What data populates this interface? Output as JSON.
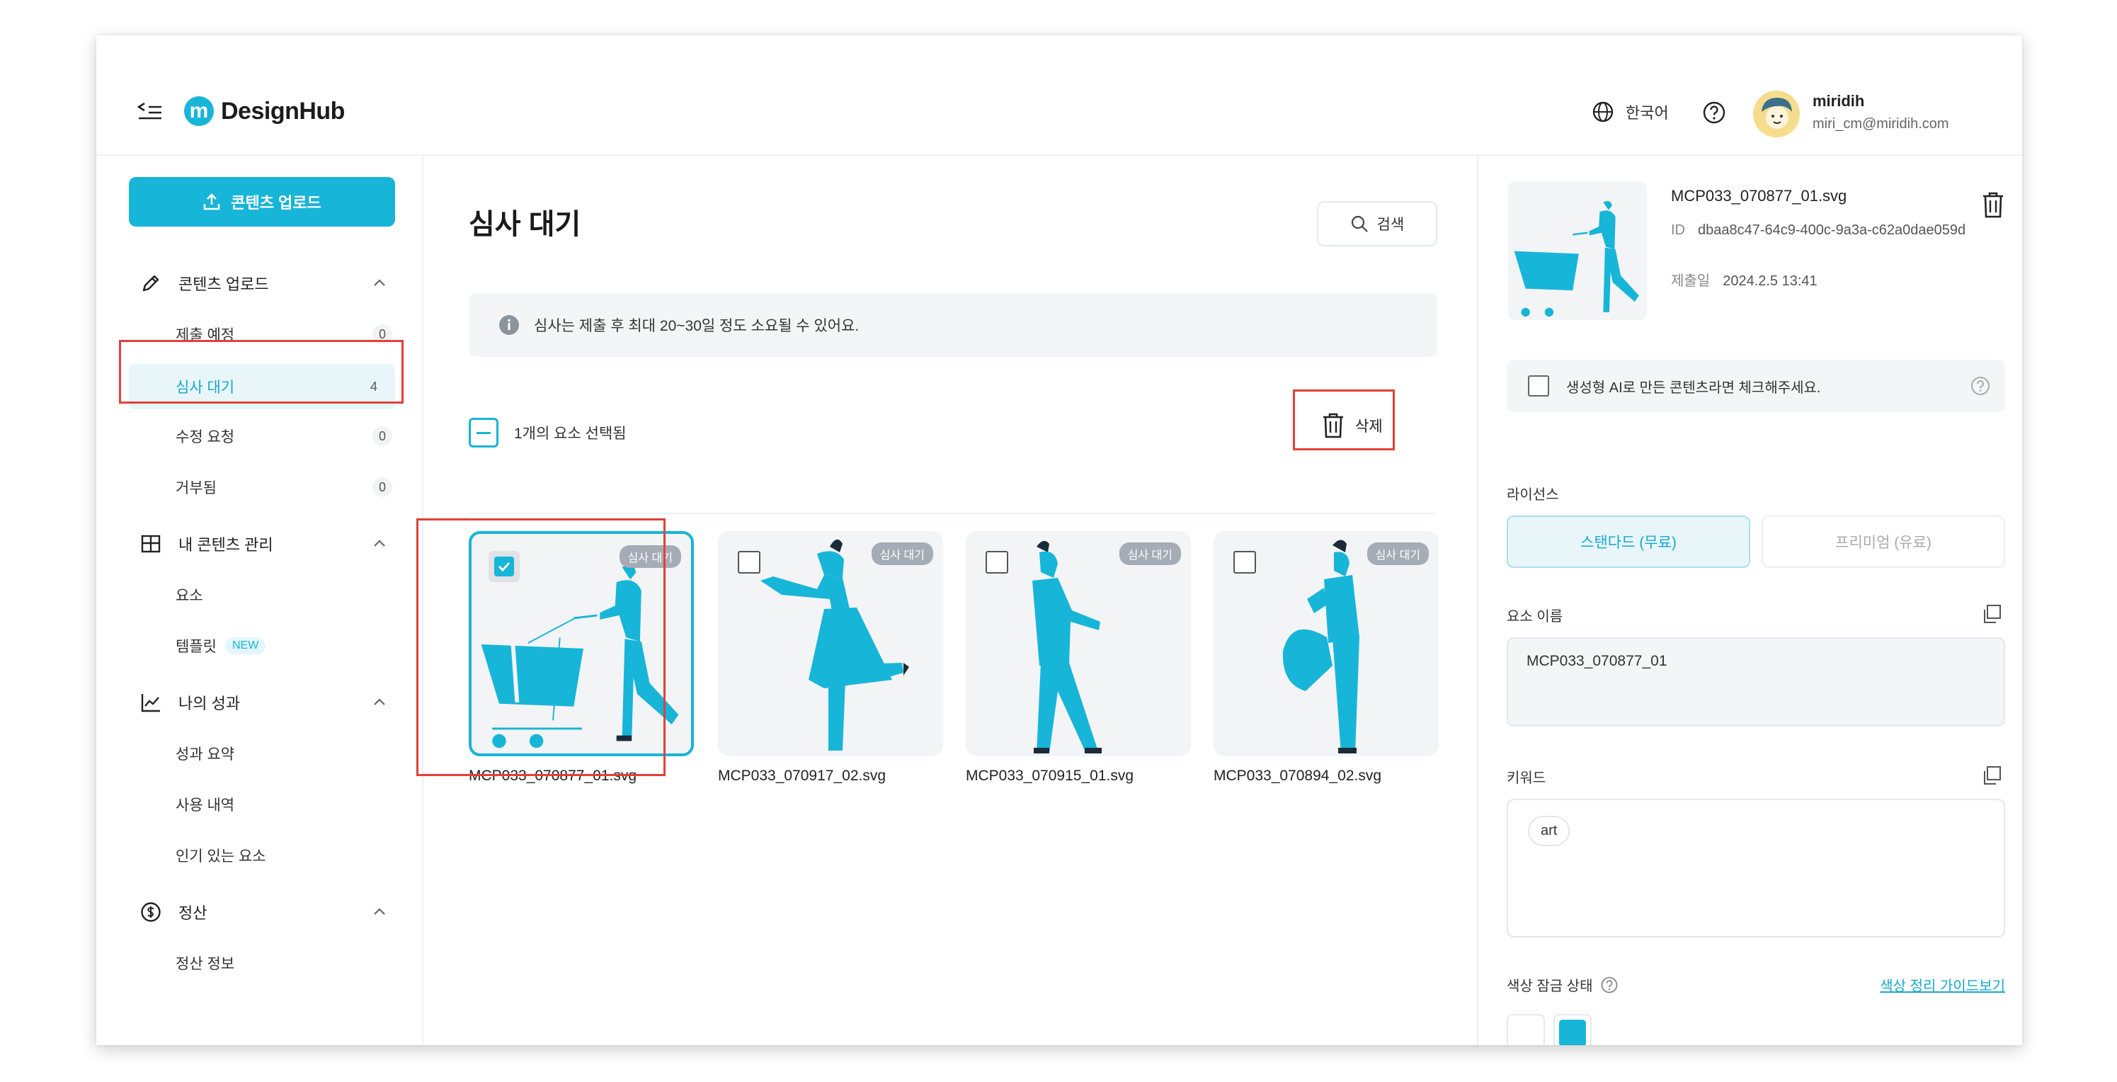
{
  "header": {
    "logo_text": "DesignHub",
    "language": "한국어",
    "user_name": "miridih",
    "user_email": "miri_cm@miridih.com"
  },
  "sidebar": {
    "upload_button": "콘텐츠 업로드",
    "sections": [
      {
        "label": "콘텐츠 업로드",
        "icon": "pencil-icon",
        "items": [
          {
            "label": "제출 예정",
            "count": "0"
          },
          {
            "label": "심사 대기",
            "count": "4",
            "active": true
          },
          {
            "label": "수정 요청",
            "count": "0"
          },
          {
            "label": "거부됨",
            "count": "0"
          }
        ]
      },
      {
        "label": "내 콘텐츠 관리",
        "icon": "grid-icon",
        "items": [
          {
            "label": "요소"
          },
          {
            "label": "템플릿",
            "badge": "NEW"
          }
        ]
      },
      {
        "label": "나의 성과",
        "icon": "chart-icon",
        "items": [
          {
            "label": "성과 요약"
          },
          {
            "label": "사용 내역"
          },
          {
            "label": "인기 있는 요소"
          }
        ]
      },
      {
        "label": "정산",
        "icon": "dollar-icon",
        "items": [
          {
            "label": "정산 정보"
          }
        ]
      }
    ]
  },
  "main": {
    "title": "심사 대기",
    "search_label": "검색",
    "info_text": "심사는 제출 후 최대 20~30일 정도 소요될 수 있어요.",
    "selection_text": "1개의 요소 선택됨",
    "delete_label": "삭제",
    "status_badge": "심사 대기",
    "cards": [
      {
        "filename": "MCP033_070877_01.svg",
        "selected": true
      },
      {
        "filename": "MCP033_070917_02.svg",
        "selected": false
      },
      {
        "filename": "MCP033_070915_01.svg",
        "selected": false
      },
      {
        "filename": "MCP033_070894_02.svg",
        "selected": false
      }
    ]
  },
  "panel": {
    "filename": "MCP033_070877_01.svg",
    "id_label": "ID",
    "id_value": "dbaa8c47-64c9-400c-9a3a-c62a0dae059d",
    "date_label": "제출일",
    "date_value": "2024.2.5 13:41",
    "ai_checkbox_label": "생성형 AI로 만든 콘텐츠라면 체크해주세요.",
    "license_label": "라이선스",
    "license_options": [
      "스탠다드 (무료)",
      "프리미엄 (유료)"
    ],
    "element_name_label": "요소 이름",
    "element_name_value": "MCP033_070877_01",
    "keyword_label": "키워드",
    "keywords": [
      "art"
    ],
    "color_lock_label": "색상 잠금 상태",
    "color_guide_link": "색상 정리 가이드보기",
    "swatches": [
      "#ffffff",
      "#17b5d8"
    ]
  },
  "colors": {
    "accent": "#17b5d8",
    "highlight_box": "#e2403a",
    "badge_gray": "#a5acb5"
  }
}
